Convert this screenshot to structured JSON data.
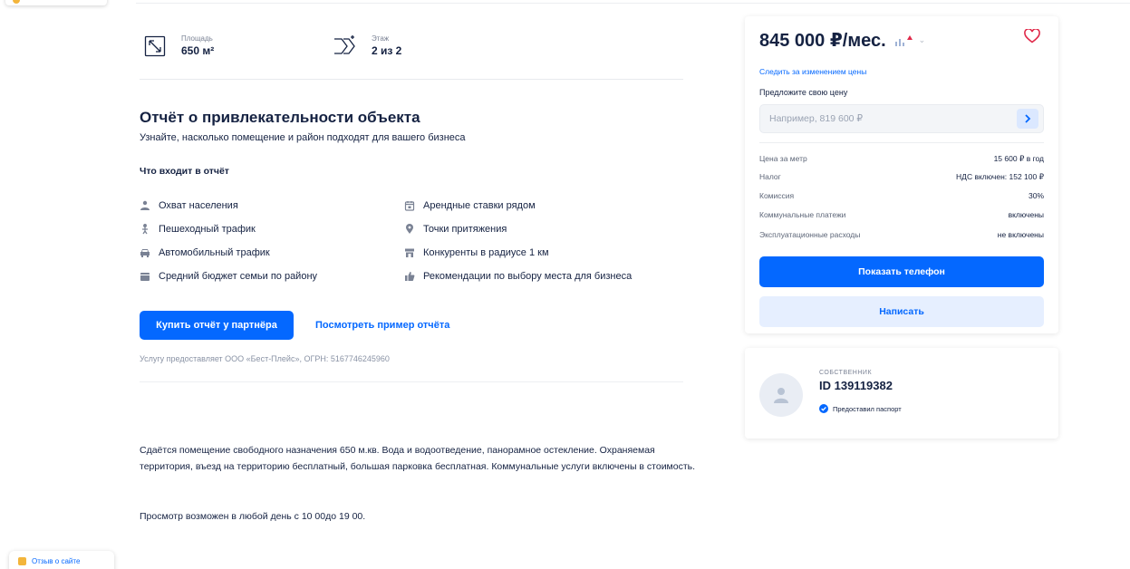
{
  "colors": {
    "accent": "#0468ff",
    "text": "#152242",
    "muted": "#7a8294",
    "heart": "#e0294a"
  },
  "stats": [
    {
      "caption": "Площадь",
      "value": "650 м²",
      "icon": "area-expand-icon"
    },
    {
      "caption": "Этаж",
      "value": "2 из 2",
      "icon": "stairs-icon"
    }
  ],
  "report": {
    "title": "Отчёт о привлекательности объекта",
    "subtitle": "Узнайте, насколько помещение и район подходят для вашего бизнеса",
    "includes_title": "Что входит в отчёт",
    "features": [
      {
        "label": "Охват населения",
        "icon": "population-icon"
      },
      {
        "label": "Пешеходный трафик",
        "icon": "pedestrian-icon"
      },
      {
        "label": "Автомобильный трафик",
        "icon": "car-icon"
      },
      {
        "label": "Средний бюджет семьи по району",
        "icon": "wallet-icon"
      },
      {
        "label": "Арендные ставки рядом",
        "icon": "calendar-icon"
      },
      {
        "label": "Точки притяжения",
        "icon": "location-pin-icon"
      },
      {
        "label": "Конкуренты в радиусе 1 км",
        "icon": "shop-icon"
      },
      {
        "label": "Рекомендации по выбору места для бизнеса",
        "icon": "thumbs-up-icon"
      }
    ],
    "buy_button": "Купить отчёт у партнёра",
    "example_link": "Посмотреть пример отчёта",
    "provider": "Услугу предоставляет ООО «Бест-Плейс», ОГРН: 5167746245960"
  },
  "description": {
    "text": "Сдаётся помещение свободного назначения 650 м.кв. Вода и водоотведение, панорамное остекление. Охраняемая территория, въезд на территорию бесплатный, большая парковка бесплатная. Коммунальные услуги включены в стоимость.",
    "viewing": "Просмотр возможен в любой день с 10 00до 19 00."
  },
  "feedback": {
    "label": "Отзыв о сайте"
  },
  "price_card": {
    "price": "845 000 ₽/мес.",
    "watch_link": "Следить за изменением цены",
    "offer_label": "Предложите свою цену",
    "offer_placeholder": "Например, 819 600 ₽",
    "details": [
      {
        "key": "Цена за метр",
        "value": "15 600 ₽ в год"
      },
      {
        "key": "Налог",
        "value": "НДС включен: 152 100 ₽"
      },
      {
        "key": "Комиссия",
        "value": "30%"
      },
      {
        "key": "Коммунальные платежи",
        "value": "включены"
      },
      {
        "key": "Эксплуатационные расходы",
        "value": "не включены"
      }
    ],
    "show_phone": "Показать телефон",
    "write": "Написать"
  },
  "owner": {
    "role": "СОБСТВЕННИК",
    "id": "ID 139119382",
    "verified": "Предоставил паспорт"
  }
}
